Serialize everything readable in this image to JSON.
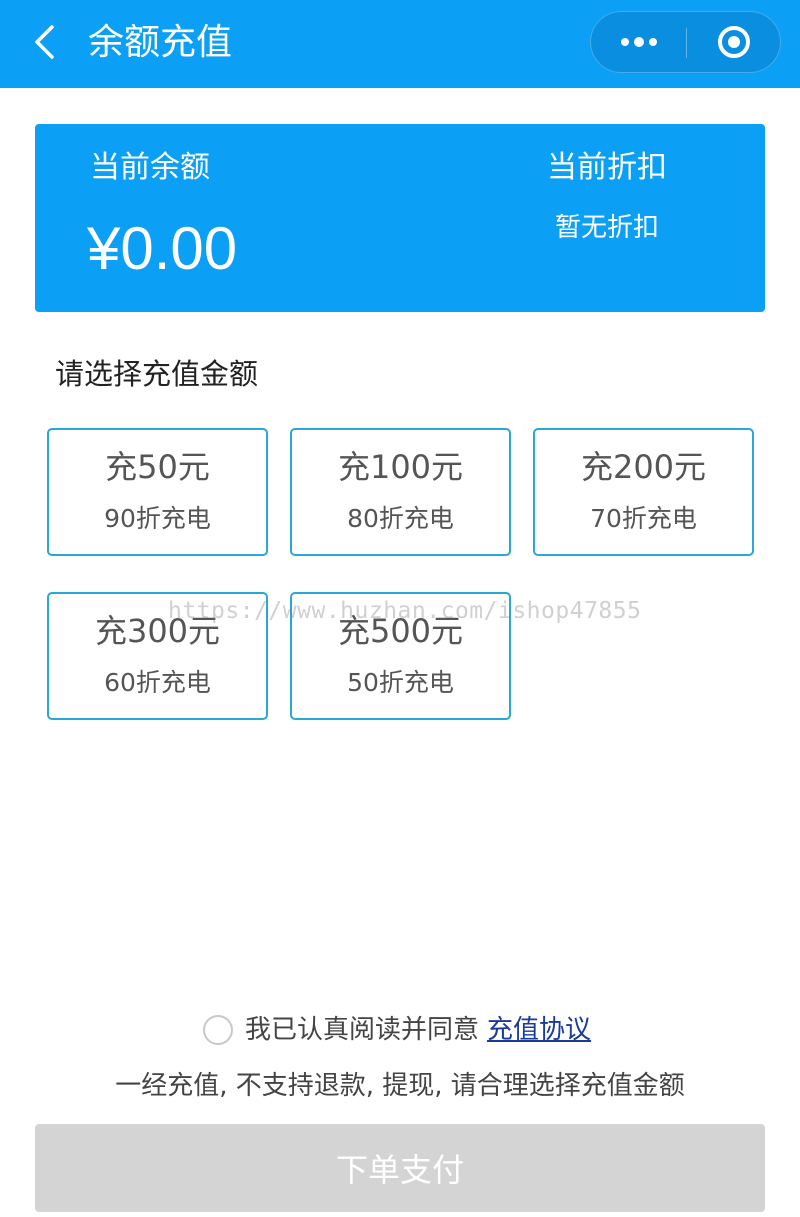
{
  "navbar": {
    "title": "余额充值",
    "back_icon": "chevron-left-icon",
    "more_icon": "more-dots-icon",
    "close_icon": "target-icon",
    "background": "#0b9ff5"
  },
  "balance": {
    "label": "当前余额",
    "amount": "¥0.00",
    "discount_label": "当前折扣",
    "discount_value": "暂无折扣"
  },
  "section": {
    "title": "请选择充值金额"
  },
  "options": [
    {
      "amount": "充50元",
      "rate": "90折充电"
    },
    {
      "amount": "充100元",
      "rate": "80折充电"
    },
    {
      "amount": "充200元",
      "rate": "70折充电"
    },
    {
      "amount": "充300元",
      "rate": "60折充电"
    },
    {
      "amount": "充500元",
      "rate": "50折充电"
    }
  ],
  "watermark": "https://www.huzhan.com/ishop47855",
  "agreement": {
    "text": "我已认真阅读并同意",
    "link": "充值协议",
    "checked": false
  },
  "notice": "一经充值, 不支持退款, 提现, 请合理选择充值金额",
  "pay_button": {
    "label": "下单支付",
    "enabled": false
  },
  "colors": {
    "accent": "#0b9ff5",
    "option_border": "#2ba6d8",
    "link": "#1a3a9c",
    "disabled_button": "#d4d4d4"
  }
}
